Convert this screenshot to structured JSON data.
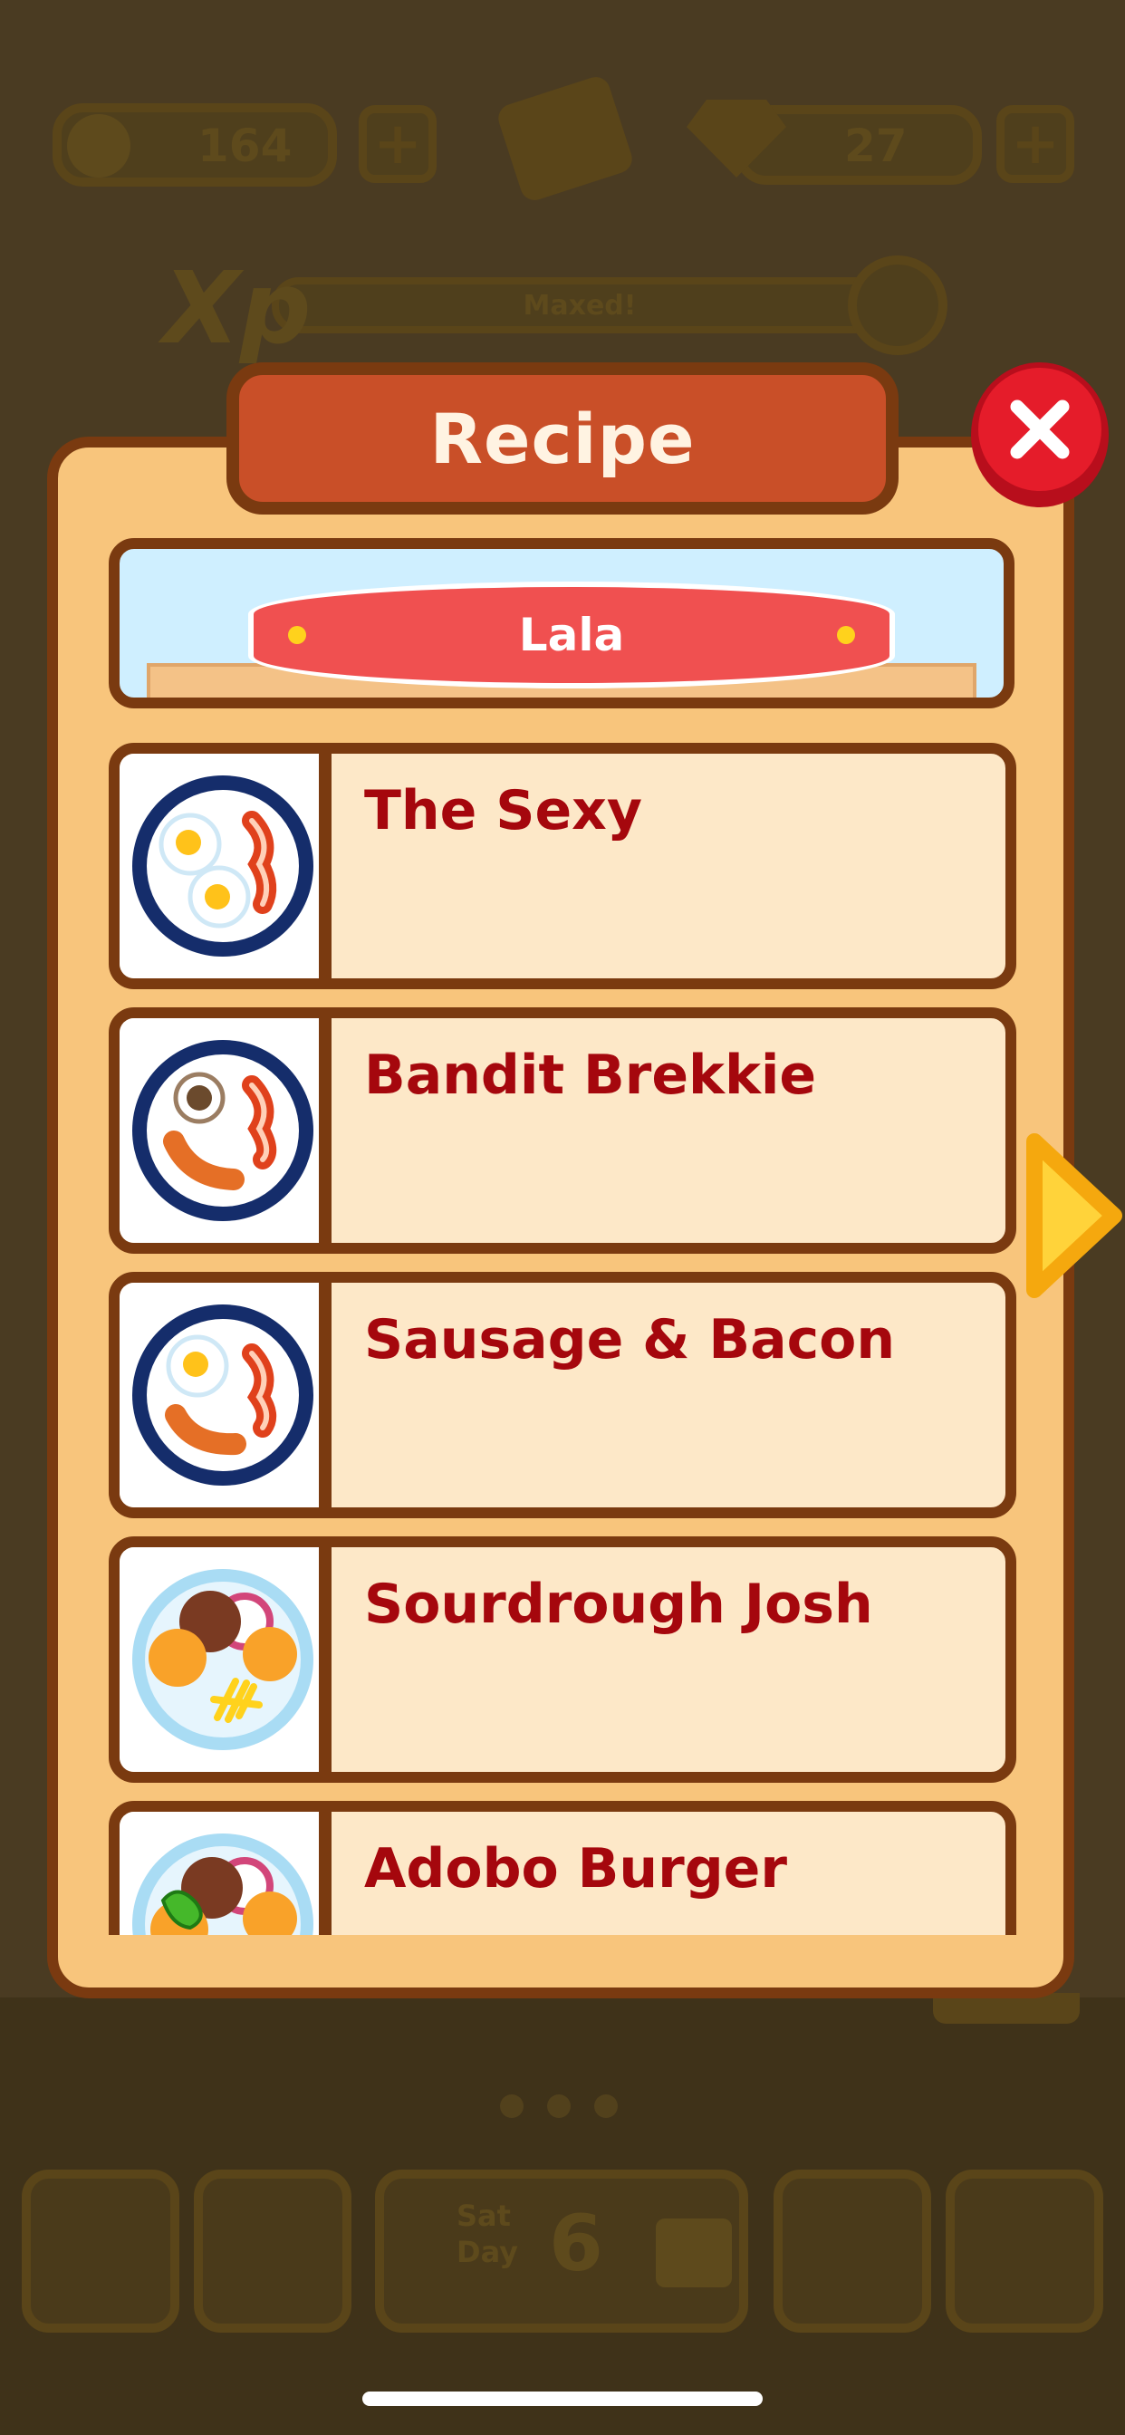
{
  "hud": {
    "coins": "164",
    "gems": "27",
    "xp_status": "Maxed!",
    "xp_badge": "Xp"
  },
  "bottom_bar": {
    "day_name": "Sat",
    "day_label": "Day",
    "day_number": "6"
  },
  "modal": {
    "title": "Recipe",
    "chef_name": "Lala",
    "recipes": [
      {
        "name": "The Sexy",
        "icon": "eggs-bacon-plate-icon"
      },
      {
        "name": "Bandit Brekkie",
        "icon": "mushroom-bacon-sausage-plate-icon"
      },
      {
        "name": "Sausage & Bacon",
        "icon": "egg-bacon-sausage-plate-icon"
      },
      {
        "name": "Sourdrough Josh",
        "icon": "patty-bun-fries-plate-icon"
      },
      {
        "name": "Adobo Burger",
        "icon": "burger-pepper-plate-icon"
      }
    ]
  },
  "colors": {
    "panel": "#f8c57c",
    "border": "#7a3a10",
    "title_banner": "#c94f28",
    "recipe_text": "#a5070d",
    "close_button": "#e51c2a",
    "arrow": "#ffd33a"
  }
}
